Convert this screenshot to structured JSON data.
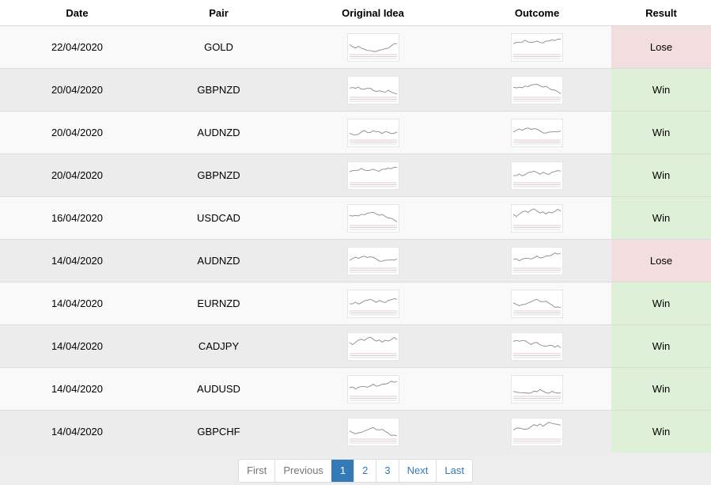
{
  "headers": {
    "date": "Date",
    "pair": "Pair",
    "idea": "Original Idea",
    "outcome": "Outcome",
    "result": "Result"
  },
  "rows": [
    {
      "date": "22/04/2020",
      "pair": "GOLD",
      "result": "Lose"
    },
    {
      "date": "20/04/2020",
      "pair": "GBPNZD",
      "result": "Win"
    },
    {
      "date": "20/04/2020",
      "pair": "AUDNZD",
      "result": "Win"
    },
    {
      "date": "20/04/2020",
      "pair": "GBPNZD",
      "result": "Win"
    },
    {
      "date": "16/04/2020",
      "pair": "USDCAD",
      "result": "Win"
    },
    {
      "date": "14/04/2020",
      "pair": "AUDNZD",
      "result": "Lose"
    },
    {
      "date": "14/04/2020",
      "pair": "EURNZD",
      "result": "Win"
    },
    {
      "date": "14/04/2020",
      "pair": "CADJPY",
      "result": "Win"
    },
    {
      "date": "14/04/2020",
      "pair": "AUDUSD",
      "result": "Win"
    },
    {
      "date": "14/04/2020",
      "pair": "GBPCHF",
      "result": "Win"
    }
  ],
  "pagination": {
    "first": "First",
    "previous": "Previous",
    "pages": [
      "1",
      "2",
      "3"
    ],
    "active_page": "1",
    "next": "Next",
    "last": "Last"
  },
  "colors": {
    "win_bg": "#dff0d8",
    "lose_bg": "#f2dede",
    "link": "#337ab7"
  },
  "icons": {
    "idea_thumbnail": "chart-thumbnail-icon",
    "outcome_thumbnail": "chart-thumbnail-icon"
  }
}
